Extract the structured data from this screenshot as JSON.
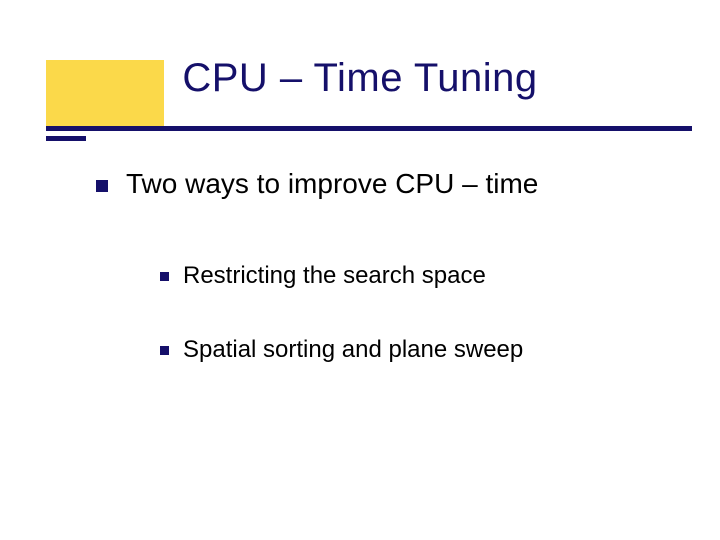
{
  "title": "CPU – Time Tuning",
  "bullets": {
    "main": "Two ways to improve CPU – time",
    "sub": [
      "Restricting the search space",
      "Spatial sorting and plane sweep"
    ]
  },
  "colors": {
    "accent_yellow": "#fbd94a",
    "accent_navy": "#15106a"
  }
}
